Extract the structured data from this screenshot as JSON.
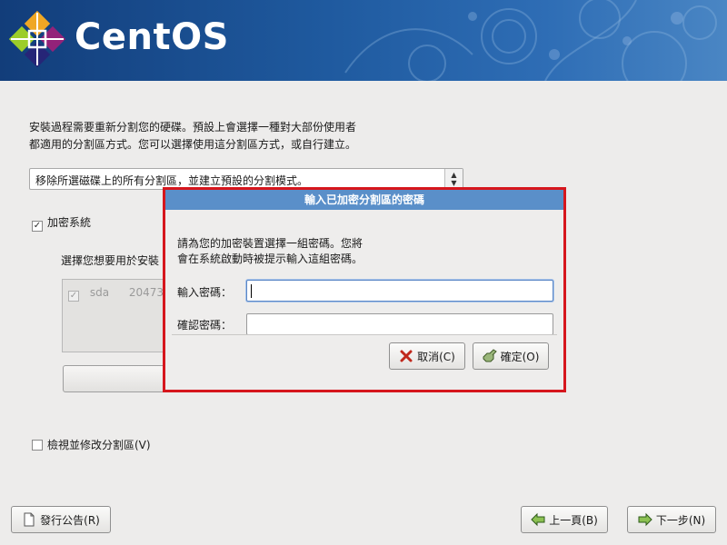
{
  "banner": {
    "logo_text": "CentOS",
    "logo_icon": "centos-logo-icon"
  },
  "description": {
    "line1": "安裝過程需要重新分割您的硬碟。預設上會選擇一種對大部份使用者",
    "line2": "都適用的分割區方式。您可以選擇使用這分割區方式，或自行建立。"
  },
  "partition_select": {
    "value": "移除所選磁碟上的所有分割區，並建立預設的分割模式。",
    "arrow_up": "▲",
    "arrow_down": "▼"
  },
  "encrypt": {
    "label": "加密系統",
    "checked": true,
    "mark": "✓"
  },
  "drives": {
    "prompt": "選擇您想要用於安裝",
    "items": [
      {
        "mark": "✓",
        "name": "sda",
        "size": "20473"
      }
    ]
  },
  "review": {
    "label": "檢視並修改分割區(V)",
    "checked": false
  },
  "bottom": {
    "release_notes": "發行公告(R)",
    "back": "上一頁(B)",
    "next": "下一步(N)"
  },
  "dialog": {
    "title": "輸入已加密分割區的密碼",
    "message_line1": "請為您的加密裝置選擇一組密碼。您將",
    "message_line2": "會在系統啟動時被提示輸入這組密碼。",
    "password_label": "輸入密碼：",
    "confirm_label": "確認密碼：",
    "password_value": "",
    "confirm_value": "",
    "cancel": "取消(C)",
    "ok": "確定(O)"
  },
  "colors": {
    "highlight_frame": "#d6161d",
    "dialog_title_bg": "#5a8fc9",
    "banner_blue": "#1f5a9f"
  }
}
